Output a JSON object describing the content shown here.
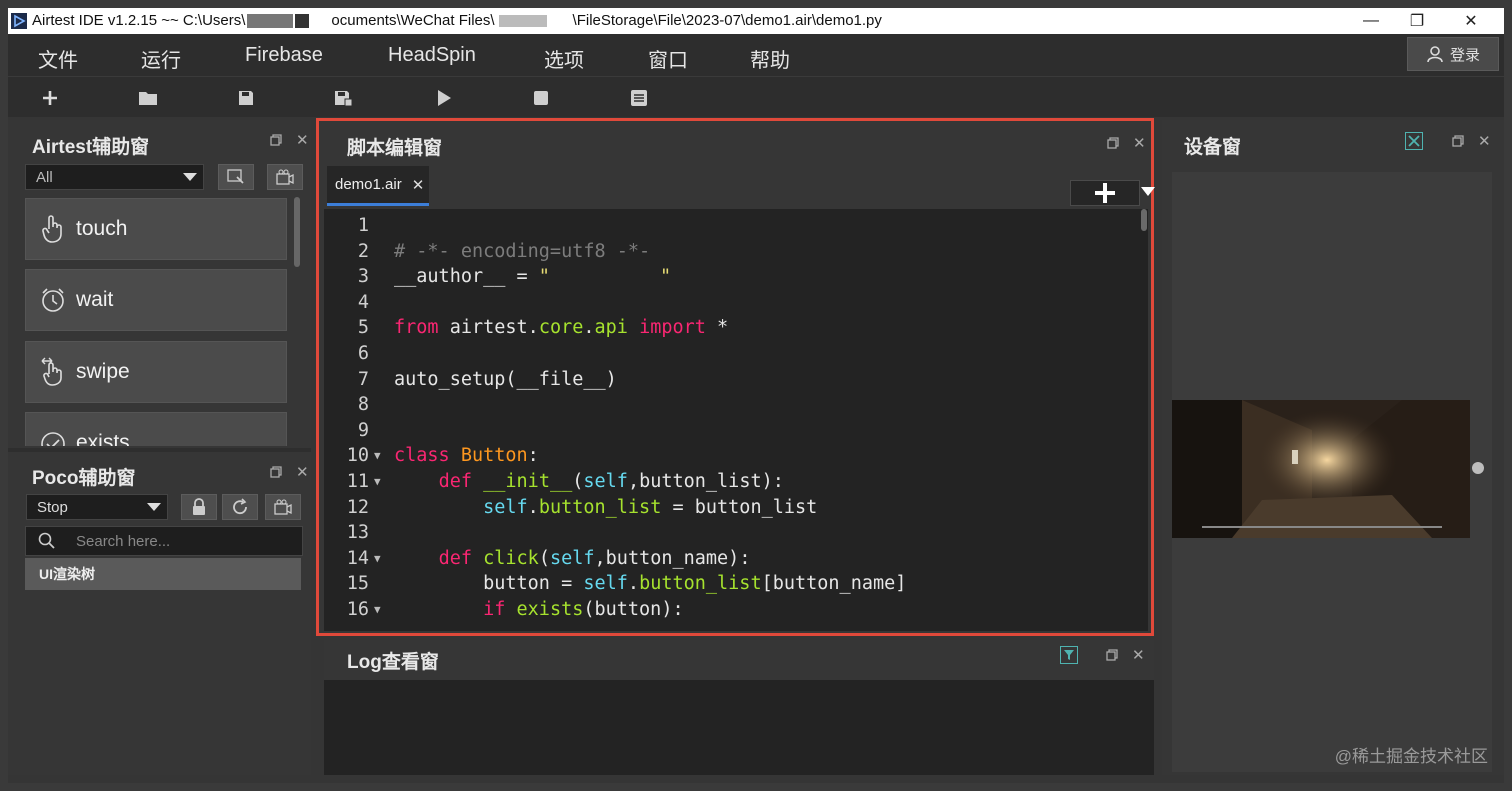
{
  "window": {
    "title": "Airtest IDE v1.2.15 ~~ C:\\Users\\",
    "title_tail": "\\FileStorage\\File\\2023-07\\demo1.air\\demo1.py",
    "title_mid": "ocuments\\WeChat Files\\"
  },
  "menu": [
    "文件",
    "运行",
    "Firebase",
    "HeadSpin",
    "选项",
    "窗口",
    "帮助"
  ],
  "login_label": "登录",
  "toolbar_icons": [
    "new-icon",
    "open-folder-icon",
    "save-icon",
    "save-as-icon",
    "run-icon",
    "stop-icon",
    "log-report-icon"
  ],
  "airtest_panel": {
    "title": "Airtest辅助窗",
    "filter": "All",
    "items": [
      {
        "label": "touch",
        "icon": "touch-hand-icon"
      },
      {
        "label": "wait",
        "icon": "alarm-clock-icon"
      },
      {
        "label": "swipe",
        "icon": "swipe-hand-icon"
      },
      {
        "label": "exists",
        "icon": "check-circle-icon"
      }
    ]
  },
  "poco_panel": {
    "title": "Poco辅助窗",
    "mode": "Stop",
    "search_placeholder": "Search here...",
    "tree_root": "UI渲染树"
  },
  "editor": {
    "title": "脚本编辑窗",
    "tab": "demo1.air",
    "lines": [
      {
        "n": "1",
        "fold": false,
        "code": ""
      },
      {
        "n": "2",
        "fold": false,
        "code": "# -*- encoding=utf8 -*-"
      },
      {
        "n": "3",
        "fold": false,
        "code": "__author__ = \"\""
      },
      {
        "n": "4",
        "fold": false,
        "code": ""
      },
      {
        "n": "5",
        "fold": false,
        "code": "from airtest.core.api import *"
      },
      {
        "n": "6",
        "fold": false,
        "code": ""
      },
      {
        "n": "7",
        "fold": false,
        "code": "auto_setup(__file__)"
      },
      {
        "n": "8",
        "fold": false,
        "code": ""
      },
      {
        "n": "9",
        "fold": false,
        "code": ""
      },
      {
        "n": "10",
        "fold": true,
        "code": "class Button:"
      },
      {
        "n": "11",
        "fold": true,
        "code": "    def __init__(self,button_list):"
      },
      {
        "n": "12",
        "fold": false,
        "code": "        self.button_list = button_list"
      },
      {
        "n": "13",
        "fold": false,
        "code": ""
      },
      {
        "n": "14",
        "fold": true,
        "code": "    def click(self,button_name):"
      },
      {
        "n": "15",
        "fold": false,
        "code": "        button = self.button_list[button_name]"
      },
      {
        "n": "16",
        "fold": true,
        "code": "        if exists(button):"
      }
    ]
  },
  "log_panel": {
    "title": "Log查看窗"
  },
  "device_panel": {
    "title": "设备窗"
  },
  "watermark": "@稀土掘金技术社区",
  "colors": {
    "highlight_border": "#e0493a",
    "tab_underline": "#3c7ed8",
    "keyword": "#f92672",
    "function": "#a6e22e",
    "class": "#fd971f",
    "self": "#66d9ef",
    "comment": "#7c7c7c",
    "string": "#e6db74"
  }
}
